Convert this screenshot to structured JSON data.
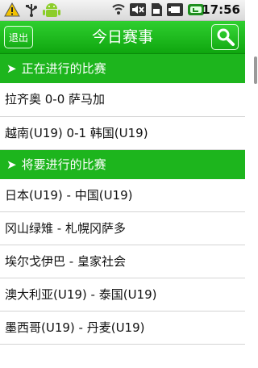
{
  "status_bar": {
    "time": "17:56",
    "icons": [
      "warning-icon",
      "usb-icon",
      "android-icon",
      "signal-icon",
      "mute-icon",
      "sim-icon",
      "battery-icon"
    ]
  },
  "title_bar": {
    "back_label": "退出",
    "title": "今日赛事",
    "search_icon": "search-icon"
  },
  "sections": [
    {
      "header": "正在进行的比赛",
      "matches": [
        "拉齐奥 0-0 萨马加",
        "越南(U19) 0-1 韩国(U19)"
      ]
    },
    {
      "header": "将要进行的比赛",
      "matches": [
        "日本(U19) - 中国(U19)",
        "冈山绿雉 - 札幌冈萨多",
        "埃尔戈伊巴 - 皇家社会",
        "澳大利亚(U19) - 泰国(U19)",
        "墨西哥(U19) - 丹麦(U19)"
      ]
    }
  ],
  "colors": {
    "accent": "#1db51d",
    "title_bar": "#19b919",
    "text": "#111111"
  }
}
